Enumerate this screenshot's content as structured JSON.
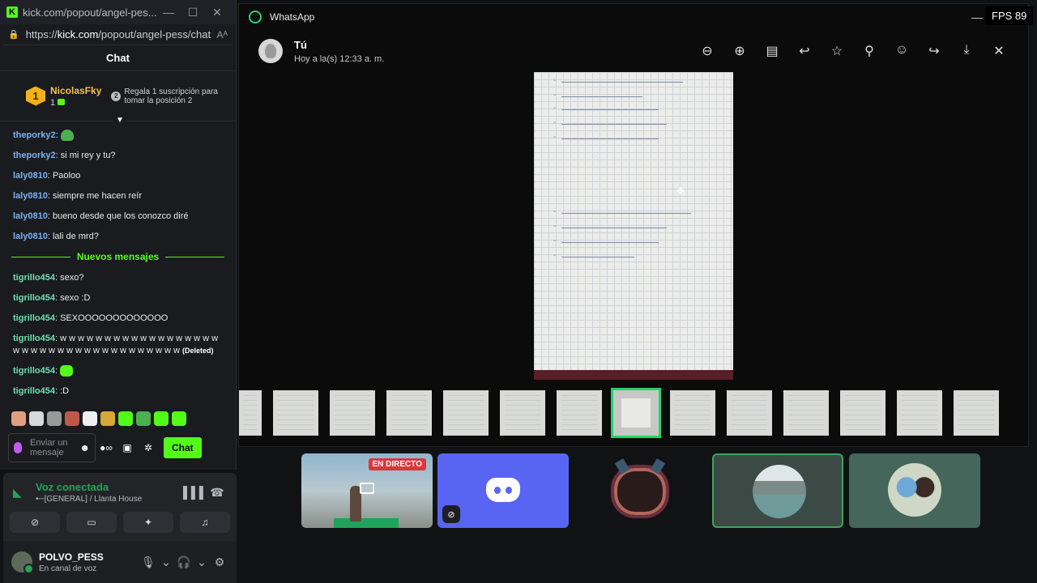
{
  "kick": {
    "tab_title": "kick.com/popout/angel-pes...",
    "url_prefix": "https://",
    "url_domain": "kick.com",
    "url_path": "/popout/angel-pess/chat",
    "chat_heading": "Chat",
    "leaderboard": {
      "first_rank": "1",
      "first_name": "NicolasFky",
      "first_count": "1",
      "second_rank": "2",
      "second_cta": "Regala 1 suscripción para tomar la posición 2"
    },
    "messages_before": [
      {
        "user": "theporky2",
        "text": "",
        "emote": true
      },
      {
        "user": "theporky2",
        "text": "si mi rey y tu?"
      },
      {
        "user": "laly0810",
        "text": "Paoloo"
      },
      {
        "user": "laly0810",
        "text": "siempre me hacen reír"
      },
      {
        "user": "laly0810",
        "text": "bueno desde que los conozco diré"
      },
      {
        "user": "laly0810",
        "text": "lali de mrd?"
      }
    ],
    "new_messages_label": "Nuevos mensajes",
    "messages_after": [
      {
        "user": "tigrillo454",
        "text": "sexo?"
      },
      {
        "user": "tigrillo454",
        "text": "sexo :D"
      },
      {
        "user": "tigrillo454",
        "text": "SEXOOOOOOOOOOOOO"
      },
      {
        "user": "tigrillo454",
        "text": "w w w w w w w w w w w w w w w w w w w w w w w w w w w w w w w w w w w w w",
        "suffix": "(Deleted)"
      },
      {
        "user": "tigrillo454",
        "text": "",
        "emote": true
      },
      {
        "user": "tigrillo454",
        "text": ":D"
      }
    ],
    "input_placeholder": "Enviar un mensaje",
    "send_label": "Chat"
  },
  "voice": {
    "status": "Voz conectada",
    "channel": "•─[GENERAL] / Llanta House",
    "username": "POLVO_PESS",
    "user_status": "En canal de voz"
  },
  "whatsapp": {
    "app_title": "WhatsApp",
    "sender": "Tú",
    "timestamp": "Hoy a la(s) 12:33 a. m."
  },
  "fps": "FPS 89",
  "streams": {
    "live_badge": "EN DIRECTO"
  },
  "colors": {
    "kick_green": "#53fc18",
    "whatsapp_green": "#25d366",
    "discord_blurple": "#5865f2",
    "voice_green": "#23a55a",
    "live_red": "#da373c"
  },
  "icons": [
    "zoom-out-icon",
    "zoom-in-icon",
    "caption-icon",
    "reply-icon",
    "star-icon",
    "pin-icon",
    "react-icon",
    "forward-icon",
    "download-icon",
    "close-icon"
  ]
}
